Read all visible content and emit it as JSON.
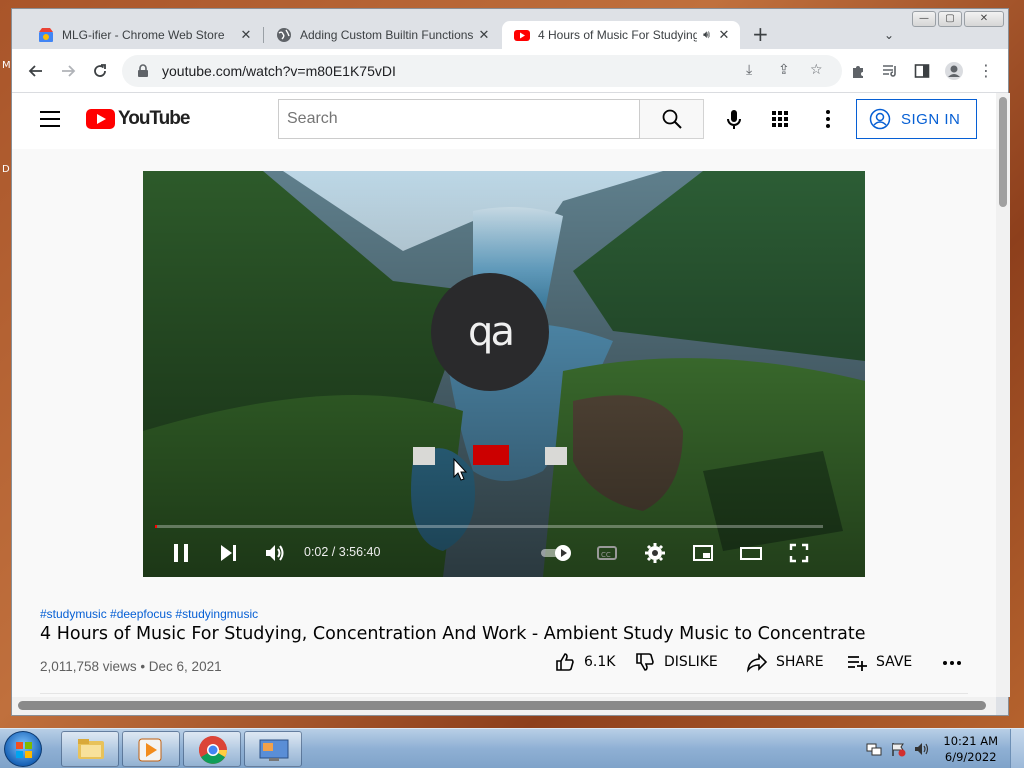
{
  "desktop": {
    "side_labels": [
      "M",
      "D"
    ]
  },
  "browser": {
    "tabs": [
      {
        "title": "MLG-ifier - Chrome Web Store",
        "icon": "chrome-web-store-icon",
        "active": false
      },
      {
        "title": "Adding Custom Builtin Functions",
        "icon": "globe-icon",
        "active": false
      },
      {
        "title": "4 Hours of Music For Studying",
        "icon": "youtube-icon",
        "active": true,
        "audio": true
      }
    ],
    "url": "youtube.com/watch?v=m80E1K75vDI",
    "window_buttons": [
      "minimize",
      "maximize",
      "close"
    ]
  },
  "youtube": {
    "search_placeholder": "Search",
    "sign_in_label": "SIGN IN",
    "logo_text": "YouTube",
    "player": {
      "current_time": "0:02",
      "duration": "3:56:40",
      "time_display": "0:02 / 3:56:40",
      "progress_fraction": 0.0001,
      "overlay_logo_text": "qa",
      "playing": true,
      "autoplay_on": true
    },
    "video": {
      "hashtags": "#studymusic #deepfocus #studyingmusic",
      "title": "4 Hours of Music For Studying, Concentration And Work - Ambient Study Music to Concentrate",
      "views": "2,011,758 views",
      "date": "Dec 6, 2021",
      "views_date": "2,011,758 views • Dec 6, 2021",
      "likes": "6.1K",
      "dislike_label": "DISLIKE",
      "share_label": "SHARE",
      "save_label": "SAVE"
    }
  },
  "taskbar": {
    "time": "10:21 AM",
    "date": "6/9/2022",
    "pinned": [
      "explorer-icon",
      "media-player-icon",
      "chrome-icon",
      "remote-desktop-icon"
    ]
  },
  "colors": {
    "youtube_red": "#ff0000",
    "link_blue": "#065fd4",
    "chrome_tab_bg": "#dee1e6"
  }
}
